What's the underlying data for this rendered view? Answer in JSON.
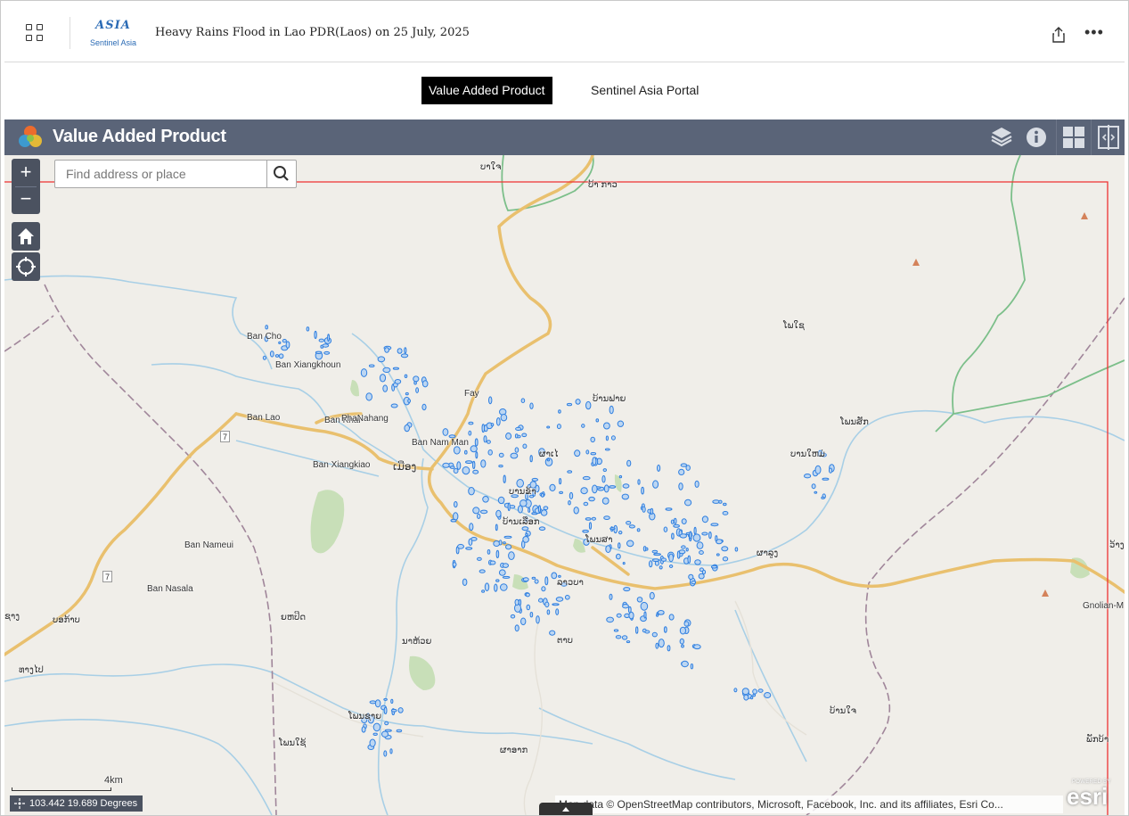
{
  "header": {
    "logo_top": "ASIA",
    "logo_bottom": "Sentinel Asia",
    "title": "Heavy Rains Flood in Lao PDR(Laos) on 25 July, 2025",
    "more_label": "•••"
  },
  "tabs": [
    {
      "label": "Value Added Product",
      "active": true
    },
    {
      "label": "Sentinel Asia Portal",
      "active": false
    }
  ],
  "widget": {
    "title": "Value Added Product",
    "buttons": [
      "layers-icon",
      "info-icon",
      "basemap-gallery-icon",
      "swipe-icon"
    ]
  },
  "map": {
    "search_placeholder": "Find address or place",
    "zoom_in": "+",
    "zoom_out": "−",
    "scale_label": "4km",
    "coordinates": "103.442 19.689 Degrees",
    "attribution": "Map data © OpenStreetMap contributors, Microsoft, Facebook, Inc. and its affiliates, Esri Co...",
    "esri_top": "POWERED BY",
    "esri_bottom": "esri",
    "flood_color": "#2f7fe0",
    "road_color": "#f2bc6a",
    "river_color": "#a8cfe6",
    "extent_color": "#e33",
    "road_shields": [
      "7",
      "7"
    ],
    "place_labels": [
      "ບາໃຈ",
      "ບ້າ ກາວ",
      "ໂພໃຊ",
      "Ban Cho",
      "Ban Xiangkhoun",
      "Fay",
      "Ban Lao",
      "Ban Khai",
      "PhaNahang",
      "Ban Nam Man",
      "Ban Xiangkiao",
      "ເມືອງ",
      "ໂພນສັກ",
      "ບານໃຫມ່",
      "Ban Nameui",
      "Ban Nasala",
      "ບອກ້າບ",
      "ຍຫປິດ",
      "ນາຫ້ວຍ",
      "ໂພນຊາຍ",
      "ຜາລູງ",
      "Gnolian-M",
      "ລາວບາ",
      "ຕາບ",
      "ໂພນໃຊ້",
      "ຜາອາກ",
      "ວ້າງ",
      "ພັກບ້າ",
      "ບ້ານໃຈ",
      "ໂພນສາ",
      "ບ້ານເລືອກ",
      "ບານຂ້າ",
      "ຜາເໄ",
      "ບ້ານຟາຍ",
      "ຊາງ",
      "ທາງໄປ"
    ]
  }
}
